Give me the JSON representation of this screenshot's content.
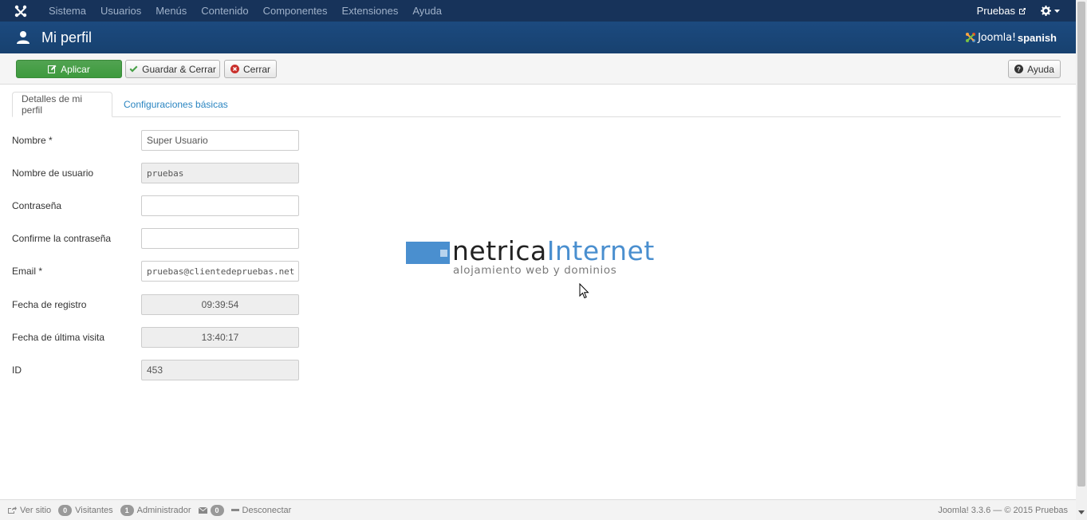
{
  "topnav": {
    "menu": [
      "Sistema",
      "Usuarios",
      "Menús",
      "Contenido",
      "Componentes",
      "Extensiones",
      "Ayuda"
    ],
    "site_name": "Pruebas"
  },
  "header": {
    "title": "Mi perfil",
    "logo_joomla": "Joomla!",
    "logo_spanish": "spanish"
  },
  "toolbar": {
    "apply_label": "Aplicar",
    "save_close_label": "Guardar & Cerrar",
    "close_label": "Cerrar",
    "help_label": "Ayuda"
  },
  "tabs": [
    {
      "label": "Detalles de mi perfil",
      "active": true
    },
    {
      "label": "Configuraciones básicas",
      "active": false
    }
  ],
  "form": {
    "name": {
      "label": "Nombre *",
      "value": "Super Usuario"
    },
    "username": {
      "label": "Nombre de usuario",
      "value": "pruebas"
    },
    "password": {
      "label": "Contraseña",
      "value": ""
    },
    "password2": {
      "label": "Confirme la contraseña",
      "value": ""
    },
    "email": {
      "label": "Email *",
      "value": "pruebas@clientedepruebas.net"
    },
    "register_date": {
      "label": "Fecha de registro",
      "value": "09:39:54"
    },
    "last_visit": {
      "label": "Fecha de última visita",
      "value": "13:40:17"
    },
    "id": {
      "label": "ID",
      "value": "453"
    }
  },
  "watermark": {
    "part1": "netrica",
    "part2": "Internet",
    "tagline": "alojamiento web y dominios"
  },
  "footer": {
    "view_site": "Ver sitio",
    "visitors_count": "0",
    "visitors_label": "Visitantes",
    "admin_count": "1",
    "admin_label": "Administrador",
    "messages_count": "0",
    "logout_label": "Desconectar",
    "copyright": "Joomla! 3.3.6  —  © 2015 Pruebas"
  },
  "colors": {
    "topnav_bg": "#17335a",
    "header_bg": "#1c4a7f",
    "apply_green": "#46a046",
    "link_blue": "#2a85c1",
    "netrica_blue": "#4a8fcf"
  }
}
